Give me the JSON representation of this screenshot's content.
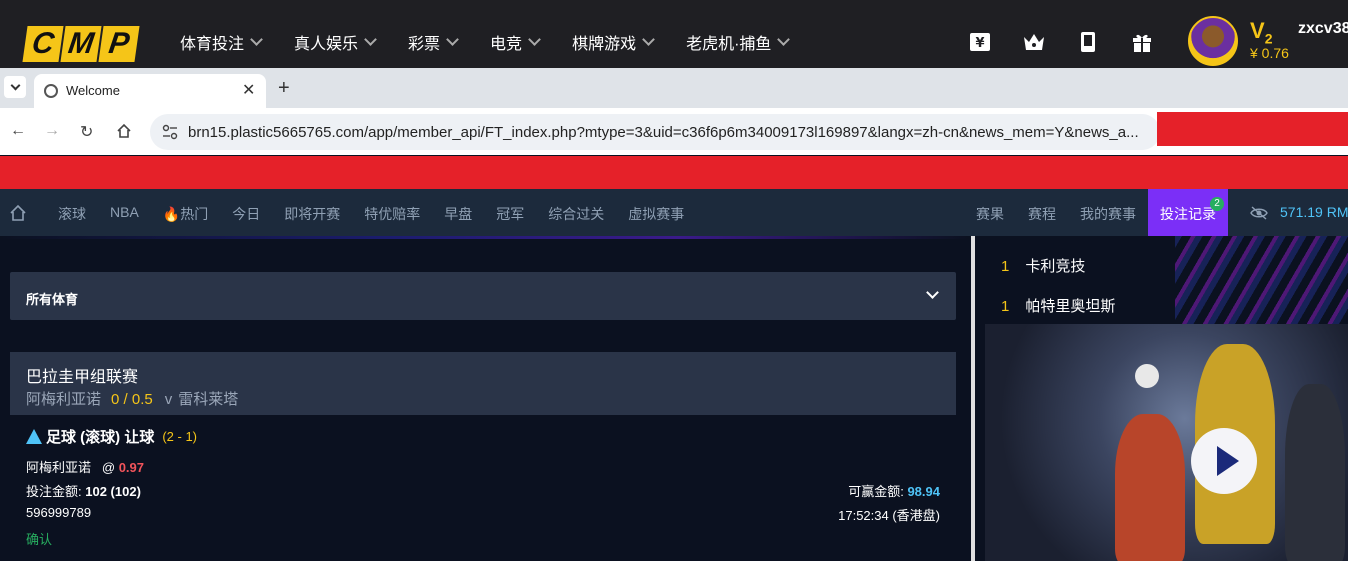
{
  "site": {
    "logo_letters": [
      "C",
      "M",
      "P"
    ],
    "nav": [
      "体育投注",
      "真人娱乐",
      "彩票",
      "电竞",
      "棋牌游戏",
      "老虎机·捕鱼"
    ],
    "vip_level": "V",
    "vip_sub": "2",
    "balance": "¥ 0.76",
    "username": "zxcv38"
  },
  "browser": {
    "tab_title": "Welcome",
    "url": "brn15.plastic5665765.com/app/member_api/FT_index.php?mtype=3&uid=c36f6p6m34009173l169897&langx=zh-cn&news_mem=Y&news_a..."
  },
  "subnav": {
    "items": [
      "滚球",
      "NBA",
      "🔥热门",
      "今日",
      "即将开赛",
      "特优赔率",
      "早盘",
      "冠军",
      "综合过关",
      "虚拟赛事"
    ],
    "right_items": [
      "赛果",
      "赛程",
      "我的赛事"
    ],
    "bet_record": "投注记录",
    "bet_record_badge": "2",
    "money": "571.19 RM"
  },
  "sport_select": {
    "label": "所有体育"
  },
  "bet": {
    "league": "巴拉圭甲组联赛",
    "home": "阿梅利亚诺",
    "handicap": "0 / 0.5",
    "vs": "v",
    "away": "雷科莱塔",
    "title": "足球 (滚球) 让球",
    "score": "(2 - 1)",
    "selection": "阿梅利亚诺",
    "at": "@",
    "odds": "0.97",
    "stake_label": "投注金额:",
    "stake_value": "102 (102)",
    "win_label": "可赢金额:",
    "win_value": "98.94",
    "ticket_id": "596999789",
    "time": "17:52:34 (香港盘)",
    "status": "确认"
  },
  "ranking": [
    {
      "n": "1",
      "name": "卡利竞技"
    },
    {
      "n": "1",
      "name": "帕特里奥坦斯"
    }
  ]
}
